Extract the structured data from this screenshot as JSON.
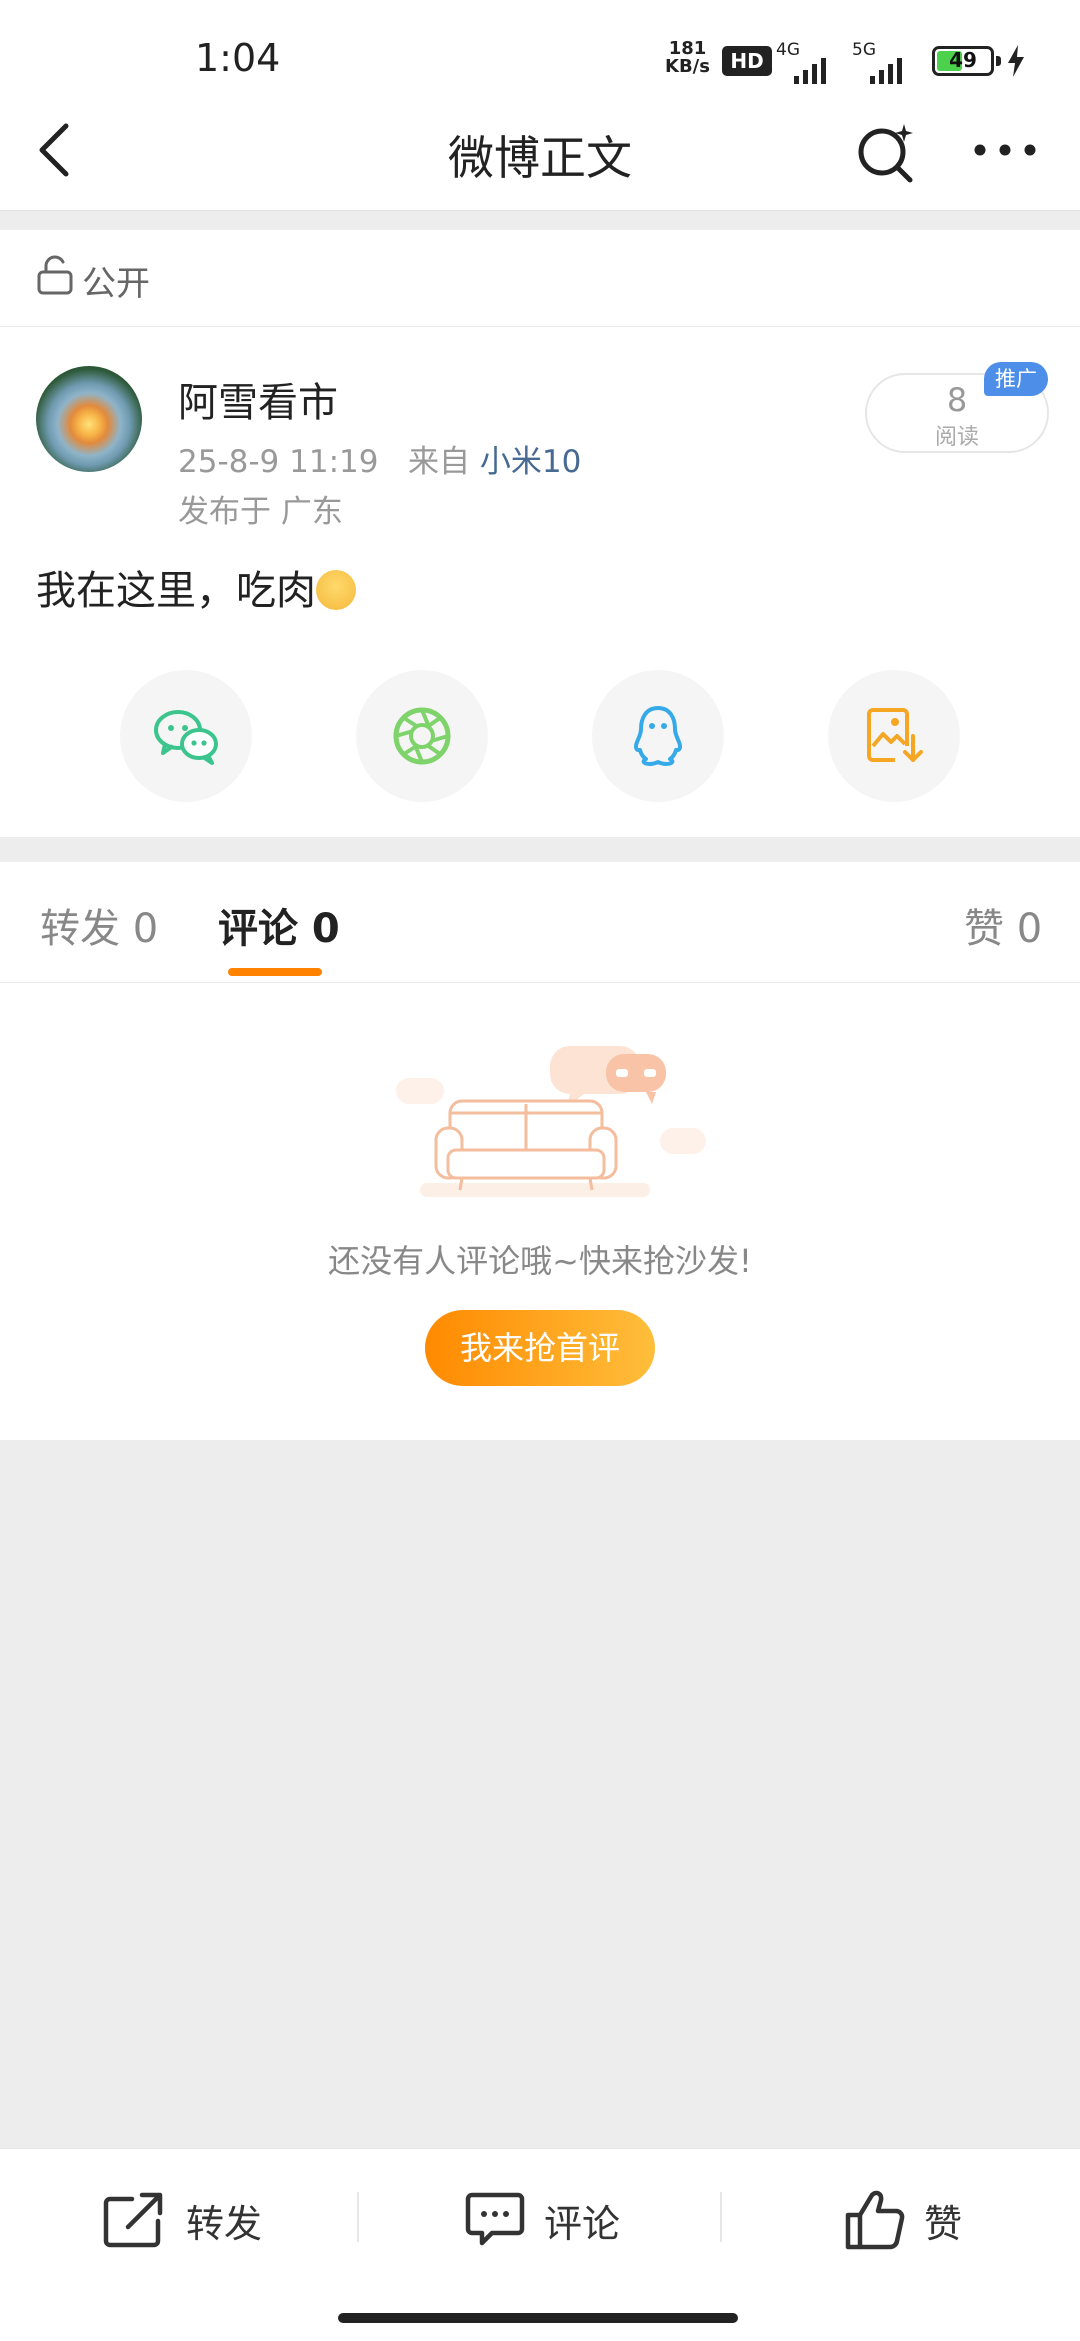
{
  "status_bar": {
    "time": "1:04",
    "net_speed_value": "181",
    "net_speed_unit": "KB/s",
    "hd_label": "HD",
    "sig1_label": "4G",
    "sig2_label": "5G",
    "battery": "49",
    "battery_level": 0.49
  },
  "nav": {
    "title": "微博正文"
  },
  "visibility": {
    "label": "公开"
  },
  "post": {
    "username": "阿雪看市",
    "time": "25-8-9 11:19",
    "from_label": "来自",
    "device": "小米10",
    "location": "发布于 广东",
    "read_count": "8",
    "read_label": "阅读",
    "promo_label": "推广",
    "text": "我在这里，吃肉"
  },
  "share_icons": [
    "wechat-icon",
    "moments-icon",
    "qq-icon",
    "save-image-icon"
  ],
  "tabs": {
    "repost": "转发 0",
    "comment": "评论 0",
    "like": "赞 0"
  },
  "empty_state": {
    "message": "还没有人评论哦~快来抢沙发!",
    "cta": "我来抢首评"
  },
  "bottom_bar": {
    "repost": "转发",
    "comment": "评论",
    "like": "赞"
  },
  "colors": {
    "accent": "#ff8200",
    "link": "#476a92",
    "promo": "#4d8ee8",
    "wechat": "#3cc48d",
    "moments": "#7ed36b",
    "qq": "#36a9e8",
    "save": "#f5a623"
  }
}
